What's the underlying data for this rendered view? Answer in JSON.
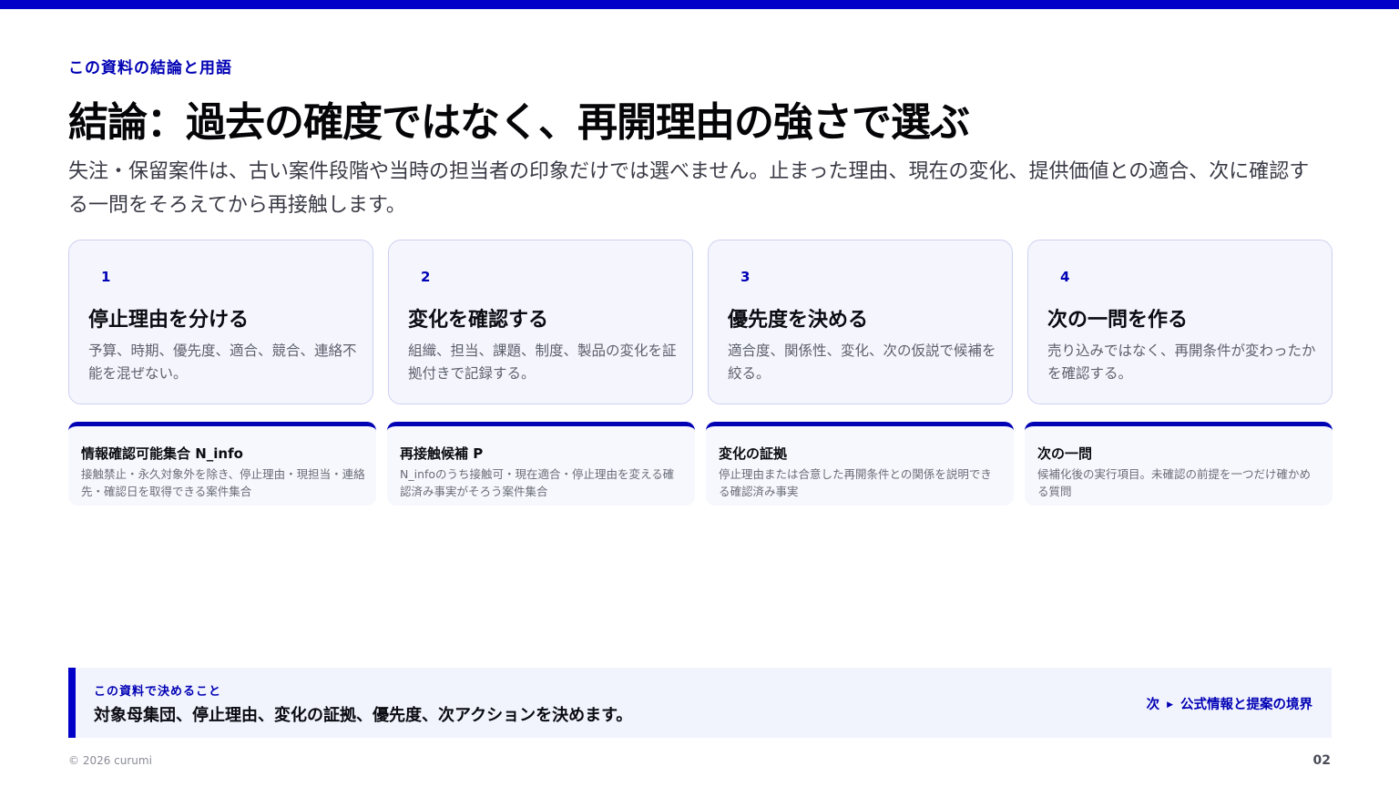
{
  "header": {
    "eyebrow": "この資料の結論と用語",
    "title": "結論：過去の確度ではなく、再開理由の強さで選ぶ",
    "lead": "失注・保留案件は、古い案件段階や当時の担当者の印象だけでは選べません。止まった理由、現在の変化、提供価値との適合、次に確認する一問をそろえてから再接触します。"
  },
  "steps": [
    {
      "number": "1",
      "title": "停止理由を分ける",
      "description": "予算、時期、優先度、適合、競合、連絡不能を混ぜない。"
    },
    {
      "number": "2",
      "title": "変化を確認する",
      "description": "組織、担当、課題、制度、製品の変化を証拠付きで記録する。"
    },
    {
      "number": "3",
      "title": "優先度を決める",
      "description": "適合度、関係性、変化、次の仮説で候補を絞る。"
    },
    {
      "number": "4",
      "title": "次の一問を作る",
      "description": "売り込みではなく、再開条件が変わったかを確認する。"
    }
  ],
  "terms": [
    {
      "title": "情報確認可能集合 N_info",
      "description": "接触禁止・永久対象外を除き、停止理由・現担当・連絡先・確認日を取得できる案件集合"
    },
    {
      "title": "再接触候補 P",
      "description": "N_infoのうち接触可・現在適合・停止理由を変える確認済み事実がそろう案件集合"
    },
    {
      "title": "変化の証拠",
      "description": "停止理由または合意した再開条件との関係を説明できる確認済み事実"
    },
    {
      "title": "次の一問",
      "description": "候補化後の実行項目。未確認の前提を一つだけ確かめる質問"
    }
  ],
  "summary": {
    "label": "この資料で決めること",
    "text": "対象母集団、停止理由、変化の証拠、優先度、次アクションを決めます。",
    "next_prefix": "次",
    "next_label": "公式情報と提案の境界"
  },
  "footer": {
    "copyright": "© 2026 curumi",
    "page_number": "02"
  },
  "colors": {
    "accent": "#0000c8",
    "card_bg": "#f5f6fd",
    "card_border": "#cdd0f2"
  }
}
